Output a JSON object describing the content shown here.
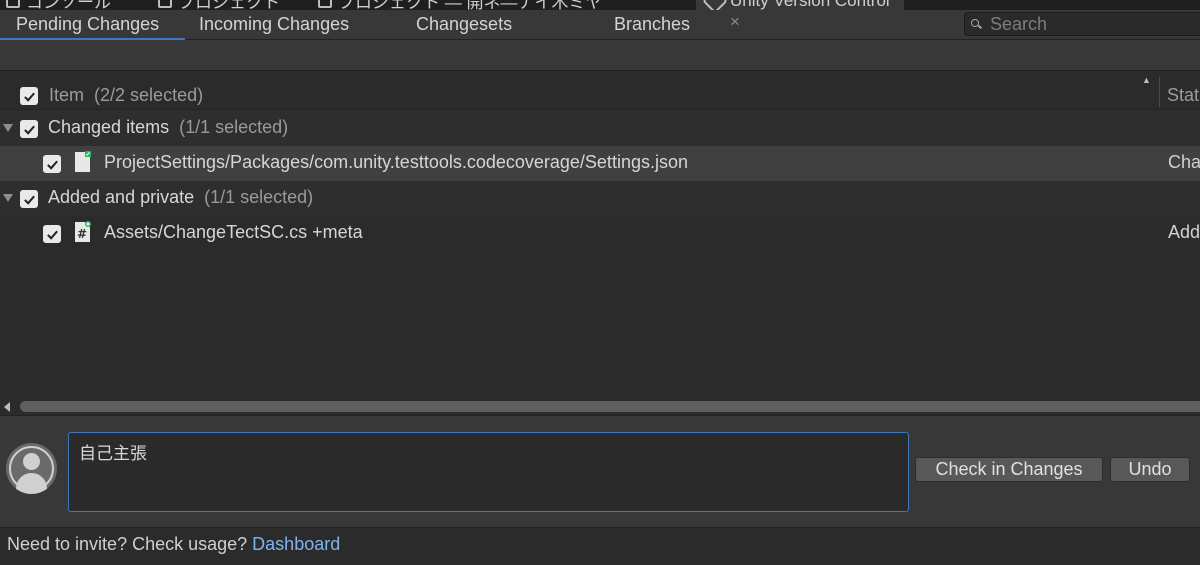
{
  "window_tabs": [
    {
      "label": "コンソール"
    },
    {
      "label": "プロジェクト"
    },
    {
      "label": "プロジェクト — 開ネ—ナイ木ミヤ"
    },
    {
      "label": "Unity Version Control"
    }
  ],
  "tabs": {
    "pending": "Pending Changes",
    "incoming": "Incoming Changes",
    "changesets": "Changesets",
    "branches": "Branches",
    "close_glyph": "×"
  },
  "search": {
    "placeholder": "Search"
  },
  "columns": {
    "item": "Item",
    "item_count": "(2/2 selected)",
    "status": "Stat"
  },
  "groups": [
    {
      "label": "Changed items",
      "count": "(1/1 selected)",
      "items": [
        {
          "path": "ProjectSettings/Packages/com.unity.testtools.codecoverage/Settings.json",
          "status": "Cha",
          "icon": "json-file-icon"
        }
      ]
    },
    {
      "label": "Added and private",
      "count": "(1/1 selected)",
      "items": [
        {
          "path": "Assets/ChangeTectSC.cs +meta",
          "status": "Add",
          "icon": "csharp-script-icon"
        }
      ]
    }
  ],
  "commit": {
    "comment": "自己主張",
    "checkin_label": "Check in Changes",
    "undo_label": "Undo"
  },
  "footer": {
    "message": "Need to invite? Check usage?",
    "link": "Dashboard"
  },
  "colors": {
    "accent": "#3a79bb",
    "link": "#7fb3ef",
    "panel": "#2b2b2b",
    "toolbar": "#383838"
  }
}
